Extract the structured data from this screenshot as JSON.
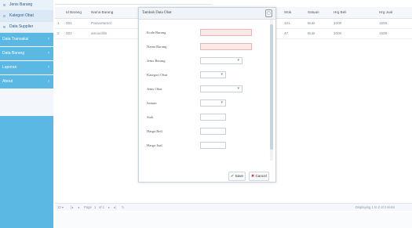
{
  "sidebar": {
    "items": [
      {
        "label": "Jenis Barang",
        "kind": "sub",
        "selected": false
      },
      {
        "label": "Kategori Obat",
        "kind": "sub",
        "selected": true
      },
      {
        "label": "Data Supplier",
        "kind": "sub",
        "selected": false
      },
      {
        "label": "Data Transaksi",
        "kind": "sec"
      },
      {
        "label": "Data Barang",
        "kind": "sec"
      },
      {
        "label": "Laporan",
        "kind": "sec"
      },
      {
        "label": "About",
        "kind": "sec"
      }
    ]
  },
  "grid": {
    "headers": [
      "Id Barang",
      "Nama Barang",
      "Stok",
      "Satuan",
      "Hrg Beli",
      "Hrg Jual"
    ],
    "rows": [
      {
        "num": "1",
        "id": "001",
        "name": "Paracetamol",
        "stok": "101",
        "satuan": "Butir",
        "beli": "1000",
        "jual": "1500"
      },
      {
        "num": "2",
        "id": "002",
        "name": "amoxcillin",
        "stok": "47",
        "satuan": "Butir",
        "beli": "1000",
        "jual": "1500"
      }
    ],
    "pager": {
      "page_label": "Page",
      "page_value": "1",
      "of_label": "of 1",
      "status": "Displaying 1 to 2 of 2 items"
    }
  },
  "dialog": {
    "title": "Tambah Data Obat",
    "fields": [
      {
        "label": "Kode Barang",
        "required": true,
        "combo": false
      },
      {
        "label": "Nama Barang",
        "required": true,
        "combo": false
      },
      {
        "label": "Jenis Barang",
        "required": false,
        "combo": true
      },
      {
        "label": "Kategori Obat",
        "required": false,
        "combo": true
      },
      {
        "label": "Jenis Obat",
        "required": false,
        "combo": true
      },
      {
        "label": "Satuan",
        "required": false,
        "combo": true
      },
      {
        "label": "Stok",
        "required": false,
        "combo": false
      },
      {
        "label": "Harga Beli",
        "required": false,
        "combo": false
      },
      {
        "label": "Harga Jual",
        "required": false,
        "combo": false
      }
    ],
    "save_label": "Save",
    "cancel_label": "Cancel"
  },
  "colors": {
    "sidebar_accent": "#5ab8e3",
    "required_field": "#fde8e8"
  }
}
